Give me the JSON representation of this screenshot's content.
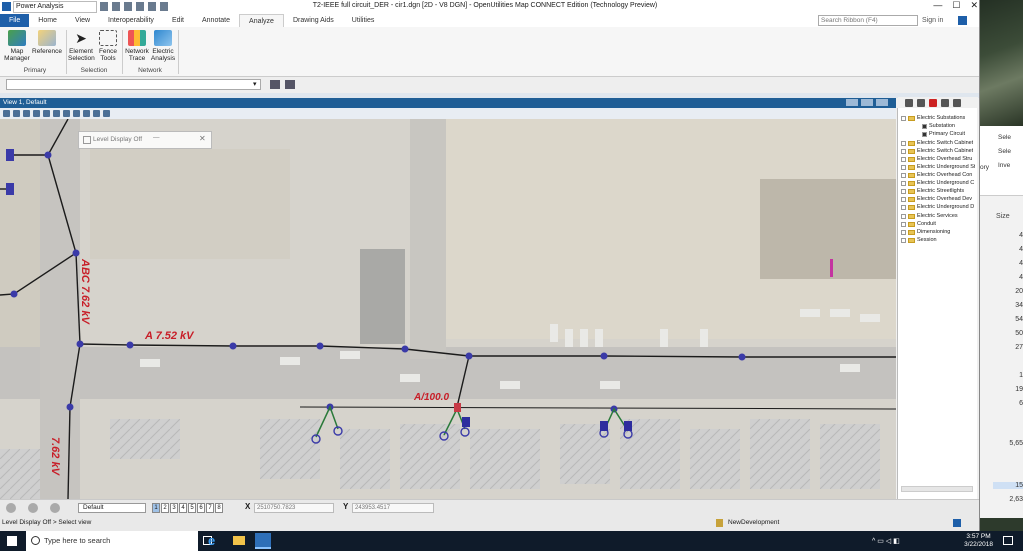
{
  "titlebar": {
    "workspace": "Power Analysis",
    "title": "T2-IEEE full circuit_DER - cir1.dgn [2D - V8 DGN] - OpenUtilities Map CONNECT Edition (Technology Preview)",
    "minimize": "—",
    "restore": "☐",
    "close": "✕"
  },
  "tabs": [
    {
      "label": "File"
    },
    {
      "label": "Home"
    },
    {
      "label": "View"
    },
    {
      "label": "Interoperability"
    },
    {
      "label": "Edit"
    },
    {
      "label": "Annotate"
    },
    {
      "label": "Analyze"
    },
    {
      "label": "Drawing Aids"
    },
    {
      "label": "Utilities"
    }
  ],
  "search_ribbon": {
    "placeholder": "Search Ribbon (F4)"
  },
  "sign_in": "Sign in",
  "ribbon": {
    "buttons": [
      {
        "label": "Map Manager"
      },
      {
        "label": "Reference"
      },
      {
        "label": "Element Selection"
      },
      {
        "label": "Fence Tools"
      },
      {
        "label": "Network Trace"
      },
      {
        "label": "Electric Analysis"
      }
    ],
    "groups": [
      {
        "label": "Primary"
      },
      {
        "label": "Selection"
      },
      {
        "label": "Network"
      }
    ]
  },
  "view": {
    "title": "View 1, Default"
  },
  "dialog": {
    "title": "Level Display Off",
    "minimize": "—",
    "close": "✕"
  },
  "map_labels": {
    "abc_762": "ABC 7.62 kV",
    "a_762": "A 7.52 kV",
    "kv_762": "7.62 kV",
    "a100": "A/100.0"
  },
  "tree": {
    "items": [
      {
        "label": "Electric Substations"
      },
      {
        "label": "Substation"
      },
      {
        "label": "Primary Circuit"
      },
      {
        "label": "Electric Switch Cabinet"
      },
      {
        "label": "Electric Switch Cabinet"
      },
      {
        "label": "Electric Overhead Stru"
      },
      {
        "label": "Electric Underground St"
      },
      {
        "label": "Electric Overhead Con"
      },
      {
        "label": "Electric Underground C"
      },
      {
        "label": "Electric Streetlights"
      },
      {
        "label": "Electric Overhead Dev"
      },
      {
        "label": "Electric Underground D"
      },
      {
        "label": "Electric Services"
      },
      {
        "label": "Conduit"
      },
      {
        "label": "Dimensioning"
      },
      {
        "label": "Session"
      }
    ]
  },
  "bottombar": {
    "view_attr": "Default",
    "views": [
      "1",
      "2",
      "3",
      "4",
      "5",
      "6",
      "7",
      "8"
    ],
    "x_label": "X",
    "x_value": "2510750.7823",
    "y_label": "Y",
    "y_value": "243953.4517"
  },
  "status": {
    "prompt": "Level Display Off > Select view",
    "model": "NewDevelopment"
  },
  "taskbar": {
    "search_placeholder": "Type here to search",
    "time": "3:57 PM",
    "date": "3/22/2018"
  },
  "right_window": {
    "items": [
      "Sele",
      "Sele",
      "Inve"
    ],
    "story": "ory",
    "size_header": "Size",
    "values": [
      "4",
      "4",
      "4",
      "4",
      "20",
      "34",
      "54",
      "50",
      "27",
      "1",
      "19",
      "6",
      "5,65",
      "15",
      "2,63"
    ]
  },
  "colors": {
    "accent": "#1e5fa9",
    "view_header": "#1f5e96",
    "wire": "#1b1b1b",
    "node": "#3a3aa8",
    "label_red": "#c81e28",
    "service": "#2b7a3a"
  }
}
